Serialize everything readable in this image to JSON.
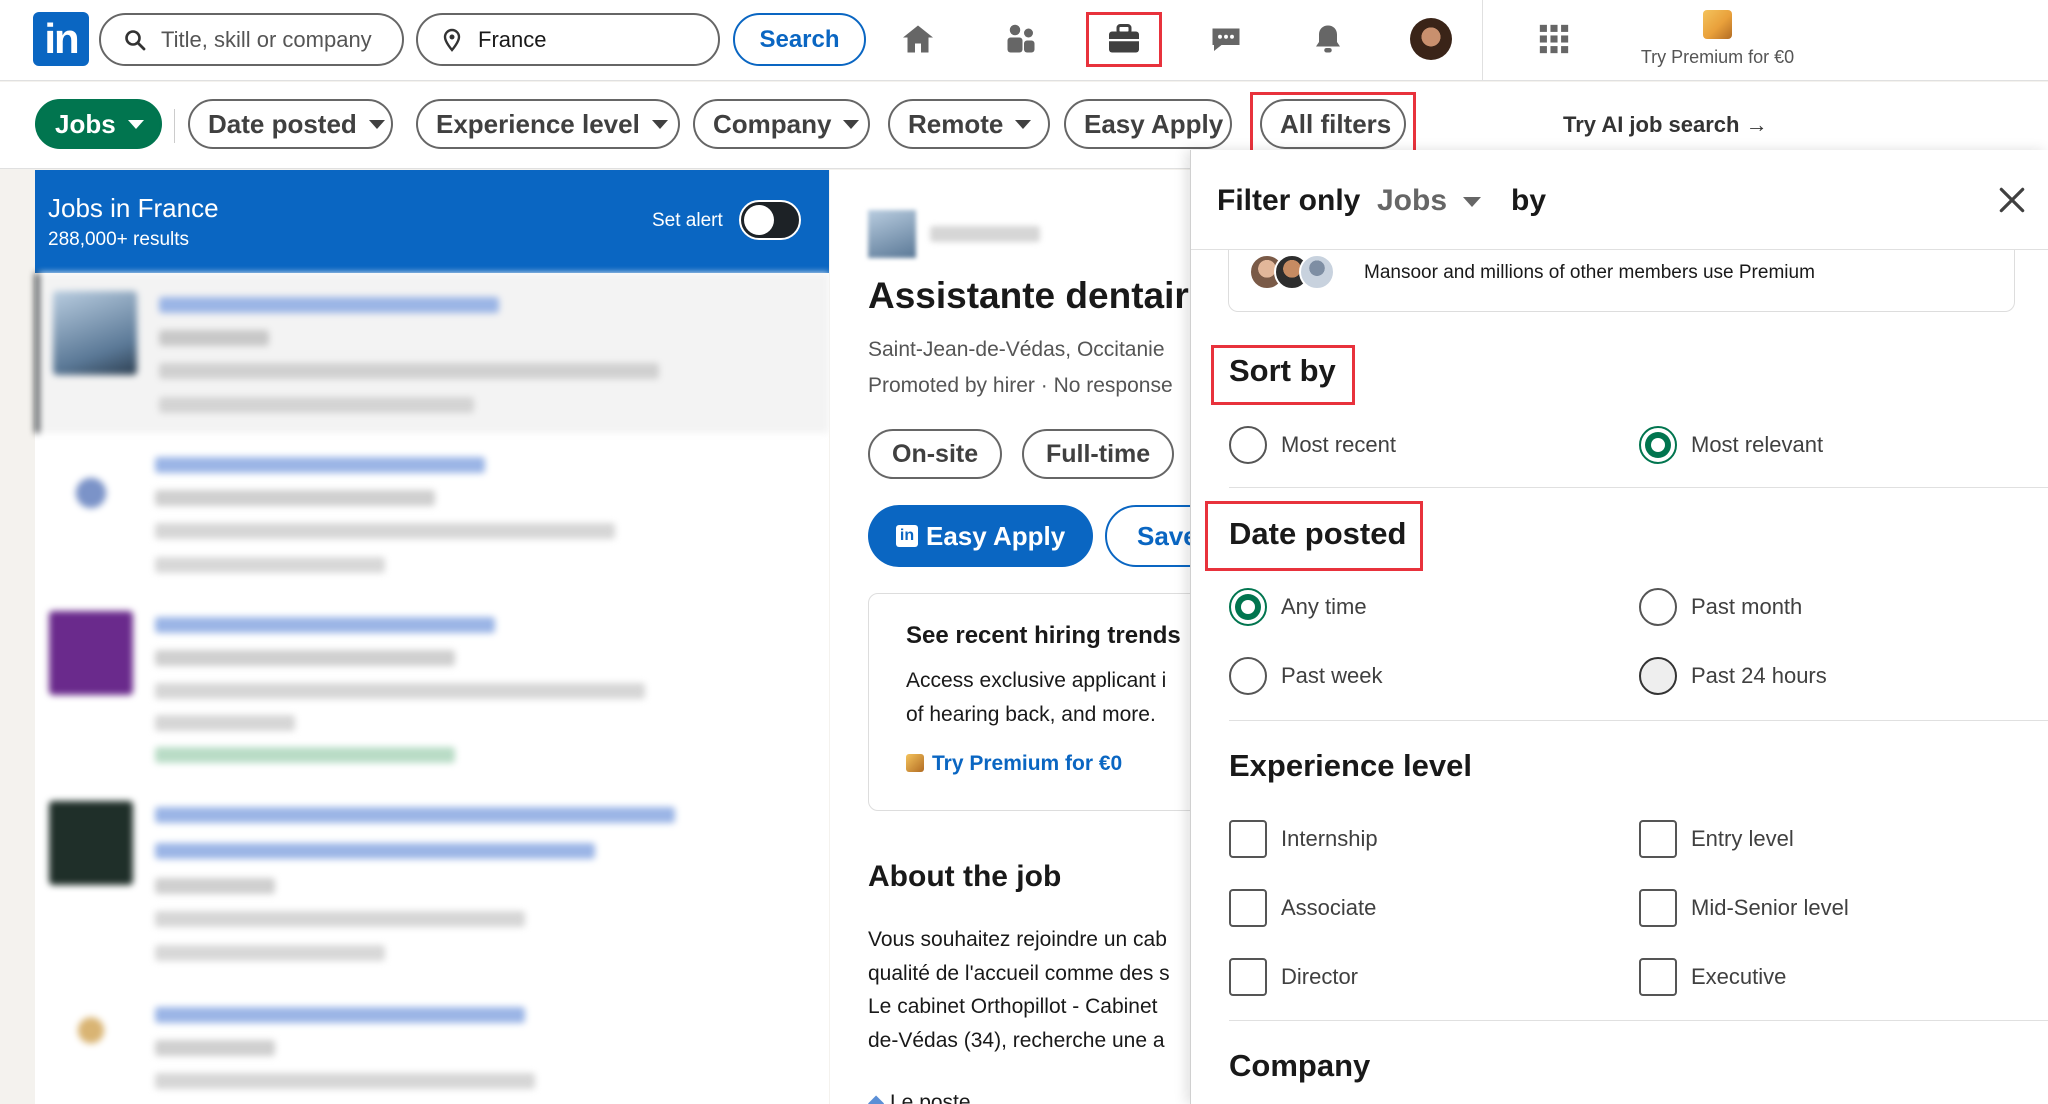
{
  "nav": {
    "search_placeholder": "Title, skill or company",
    "location_value": "France",
    "search_button": "Search",
    "icons": [
      "home-icon",
      "my-network-icon",
      "jobs-icon",
      "messaging-icon",
      "notifications-icon",
      "profile-avatar",
      "apps-grid-icon"
    ],
    "premium_label": "Try Premium for €0",
    "logo_text": "in"
  },
  "filters": {
    "jobs": "Jobs",
    "date_posted": "Date posted",
    "experience_level": "Experience level",
    "company": "Company",
    "remote": "Remote",
    "easy_apply": "Easy Apply",
    "all_filters": "All filters",
    "ai_search": "Try AI job search"
  },
  "results": {
    "title": "Jobs in France",
    "count": "288,000+ results",
    "set_alert": "Set alert"
  },
  "detail": {
    "title": "Assistante dentaire",
    "location": "Saint-Jean-de-Védas, Occitanie",
    "promoted": "Promoted by hirer · No response",
    "chip_onsite": "On-site",
    "chip_fulltime": "Full-time",
    "easy_apply": "Easy Apply",
    "save": "Save",
    "trends_title": "See recent hiring trends",
    "trends_line1": "Access exclusive applicant i",
    "trends_line2": "of hearing back, and more.",
    "trends_cta": "Try Premium for €0",
    "about_title": "About the job",
    "about_lines": [
      "Vous souhaitez rejoindre un cab",
      "qualité de l'accueil comme des s",
      "Le cabinet Orthopillot - Cabinet",
      "de-Védas (34), recherche une a",
      "Le poste"
    ]
  },
  "panel": {
    "filter_only": "Filter only",
    "filter_type": "Jobs",
    "by": "by",
    "promo_text": "Mansoor and millions of other members use Premium",
    "sort_title": "Sort by",
    "sort_options": [
      "Most recent",
      "Most relevant"
    ],
    "sort_selected": "Most relevant",
    "date_title": "Date posted",
    "date_options": [
      "Any time",
      "Past month",
      "Past week",
      "Past 24 hours"
    ],
    "date_selected": "Any time",
    "exp_title": "Experience level",
    "exp_options": [
      "Internship",
      "Entry level",
      "Associate",
      "Mid-Senior level",
      "Director",
      "Executive"
    ],
    "company_title": "Company"
  },
  "colors": {
    "brand_blue": "#0a66c2",
    "selected_green": "#01754f",
    "highlight_red": "#e8323c"
  }
}
